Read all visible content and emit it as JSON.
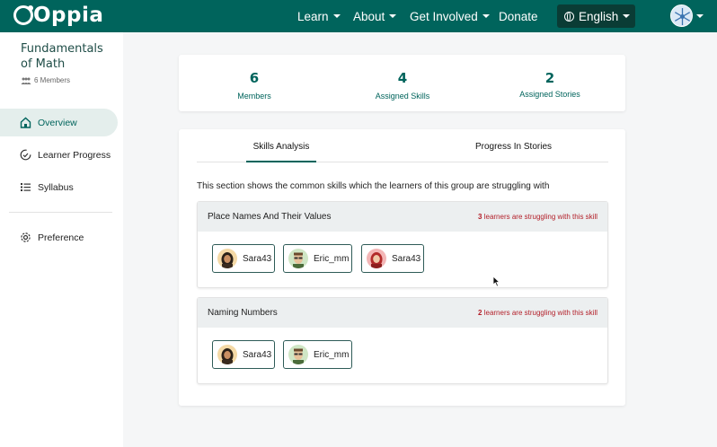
{
  "nav": {
    "logo": "Oppia",
    "items": [
      "Learn",
      "About",
      "Get Involved",
      "Donate"
    ],
    "language": "English"
  },
  "sidebar": {
    "group_title": "Fundamentals of Math",
    "members": "6 Members",
    "items": [
      "Overview",
      "Learner Progress",
      "Syllabus",
      "Preference"
    ]
  },
  "stats": [
    {
      "value": "6",
      "label": "Members"
    },
    {
      "value": "4",
      "label": "Assigned Skills"
    },
    {
      "value": "2",
      "label": "Assigned Stories"
    }
  ],
  "tabs": [
    "Skills Analysis",
    "Progress In Stories"
  ],
  "intro": "This section shows the common skills which the learners of this group are struggling with",
  "skills": [
    {
      "name": "Place Names And Their Values",
      "count": "3",
      "struggle_text": "learners are struggling with this skill",
      "learners": [
        "Sara43",
        "Eric_mm",
        "Sara43"
      ]
    },
    {
      "name": "Naming Numbers",
      "count": "2",
      "struggle_text": "learners are struggling with this skill",
      "learners": [
        "Sara43",
        "Eric_mm"
      ]
    }
  ],
  "colors": {
    "brand": "#00645c",
    "danger": "#b3202a"
  }
}
